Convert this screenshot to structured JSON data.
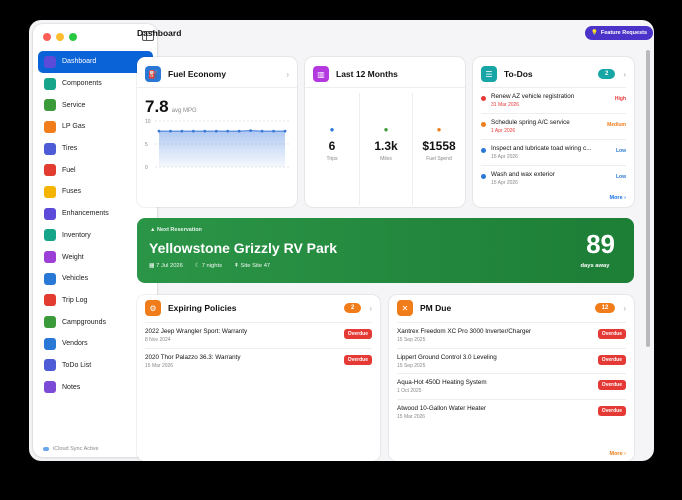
{
  "window": {
    "title": "Dashboard",
    "feature_button": "Feature Requests"
  },
  "sidebar": {
    "sync_status": "iCloud Sync Active",
    "items": [
      {
        "label": "Dashboard",
        "icon": "info-icon",
        "color": "#5b4bd8",
        "active": true
      },
      {
        "label": "Components",
        "icon": "components-icon",
        "color": "#17a589"
      },
      {
        "label": "Service",
        "icon": "wrench-icon",
        "color": "#3b9b3b"
      },
      {
        "label": "LP Gas",
        "icon": "flame-icon",
        "color": "#f07d1a"
      },
      {
        "label": "Tires",
        "icon": "tire-icon",
        "color": "#4d5bd6"
      },
      {
        "label": "Fuel",
        "icon": "fuel-icon",
        "color": "#e23b2f"
      },
      {
        "label": "Fuses",
        "icon": "bolt-icon",
        "color": "#f4b400"
      },
      {
        "label": "Enhancements",
        "icon": "plus-icon",
        "color": "#5b4bd8"
      },
      {
        "label": "Inventory",
        "icon": "box-icon",
        "color": "#17a589"
      },
      {
        "label": "Weight",
        "icon": "weight-icon",
        "color": "#9b3fd6"
      },
      {
        "label": "Vehicles",
        "icon": "car-icon",
        "color": "#2a78d6"
      },
      {
        "label": "Trip Log",
        "icon": "map-icon",
        "color": "#e23b2f"
      },
      {
        "label": "Campgrounds",
        "icon": "tent-icon",
        "color": "#3b9b3b"
      },
      {
        "label": "Vendors",
        "icon": "store-icon",
        "color": "#2a78d6"
      },
      {
        "label": "ToDo List",
        "icon": "checklist-icon",
        "color": "#4d5bd6"
      },
      {
        "label": "Notes",
        "icon": "note-icon",
        "color": "#7b4bd8"
      }
    ]
  },
  "fuel_economy": {
    "title": "Fuel Economy",
    "value": "7.8",
    "unit": "avg MPG",
    "y_ticks": [
      "10",
      "5",
      "0"
    ]
  },
  "last12": {
    "title": "Last 12 Months",
    "stats": [
      {
        "value": "6",
        "label": "Trips",
        "icon": "map-icon",
        "color": "#2a78d6"
      },
      {
        "value": "1.3k",
        "label": "Miles",
        "icon": "road-icon",
        "color": "#3b9b3b"
      },
      {
        "value": "$1558",
        "label": "Fuel Spend",
        "icon": "fuel-icon",
        "color": "#f07d1a"
      }
    ]
  },
  "todos": {
    "title": "To-Dos",
    "count": "2",
    "more": "More",
    "items": [
      {
        "title": "Renew AZ vehicle registration",
        "date": "31 Mar 2026",
        "priority": "High",
        "dot": "#e53935",
        "date_color": "#e53935",
        "priority_color": "#e53935"
      },
      {
        "title": "Schedule spring A/C service",
        "date": "1 Apr 2026",
        "priority": "Medium",
        "dot": "#f07d1a",
        "date_color": "#e53935",
        "priority_color": "#f07d1a"
      },
      {
        "title": "Inspect and lubricate toad wiring c...",
        "date": "15 Apr 2026",
        "priority": "Low",
        "dot": "#2a78d6",
        "date_color": "#888888",
        "priority_color": "#2a78d6"
      },
      {
        "title": "Wash and wax exterior",
        "date": "15 Apr 2026",
        "priority": "Low",
        "dot": "#2a78d6",
        "date_color": "#888888",
        "priority_color": "#2a78d6"
      }
    ]
  },
  "reservation": {
    "heading": "Next Reservation",
    "name": "Yellowstone Grizzly RV Park",
    "date": "7 Jul 2026",
    "nights": "7 nights",
    "site": "Site Site 47",
    "days": "89",
    "days_label": "days away"
  },
  "policies": {
    "title": "Expiring Policies",
    "count": "2",
    "items": [
      {
        "title": "2022 Jeep Wrangler Sport: Warranty",
        "date": "8 Nov 2024",
        "status": "Overdue"
      },
      {
        "title": "2020 Thor Palazzo 36.3: Warranty",
        "date": "15 Mar 2026",
        "status": "Overdue"
      }
    ]
  },
  "pm_due": {
    "title": "PM Due",
    "count": "12",
    "more": "More",
    "items": [
      {
        "title": "Xantrex Freedom XC Pro 3000 Inverter/Charger",
        "date": "15 Sep 2025",
        "status": "Overdue"
      },
      {
        "title": "Lippert Ground Control 3.0 Leveling",
        "date": "15 Sep 2025",
        "status": "Overdue"
      },
      {
        "title": "Aqua-Hot 450D Heating System",
        "date": "1 Oct 2025",
        "status": "Overdue"
      },
      {
        "title": "Atwood 10-Gallon Water Heater",
        "date": "15 Mar 2026",
        "status": "Overdue"
      }
    ]
  },
  "chart_data": {
    "type": "area",
    "title": "",
    "ylim": [
      0,
      10
    ],
    "values": [
      7.8,
      7.8,
      7.8,
      7.8,
      7.8,
      7.8,
      7.8,
      7.8,
      7.9,
      7.8,
      7.8,
      7.8
    ]
  }
}
